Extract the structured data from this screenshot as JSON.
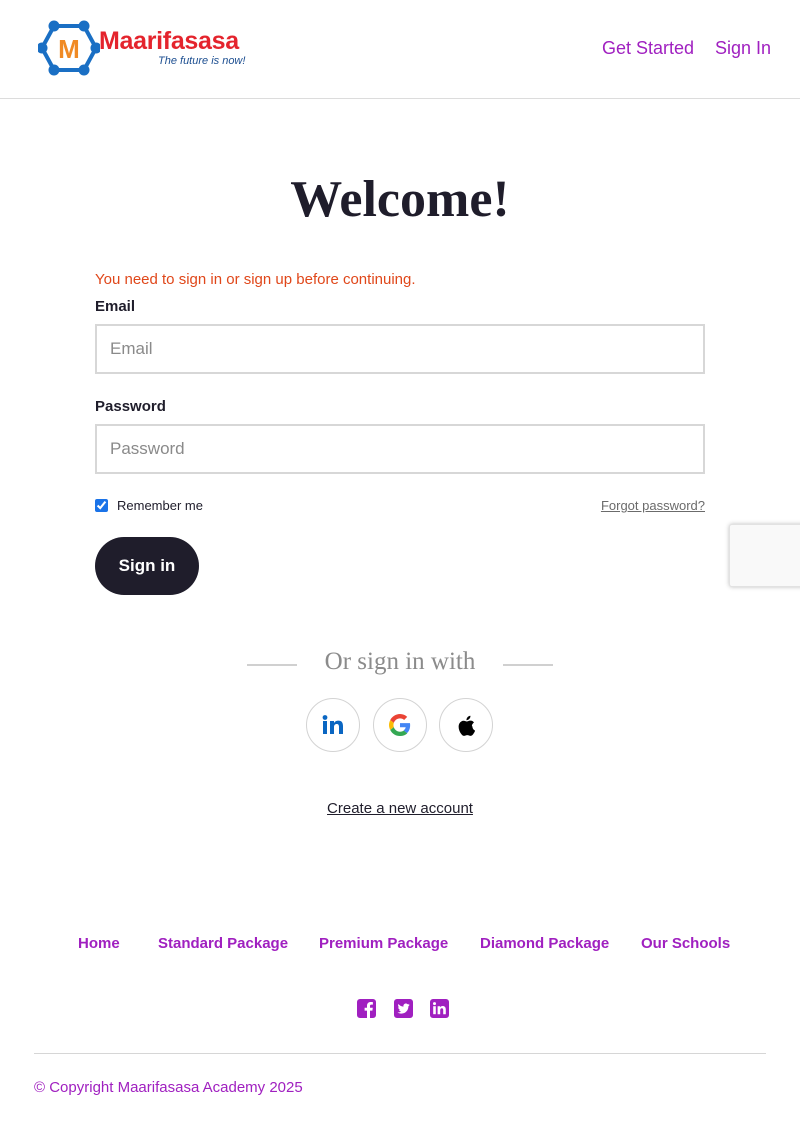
{
  "brand": {
    "name": "Maarifasasa",
    "tagline": "The future is now!",
    "logo_letter": "M"
  },
  "nav": {
    "get_started": "Get Started",
    "sign_in": "Sign In"
  },
  "page": {
    "title": "Welcome!",
    "alert": "You need to sign in or sign up before continuing."
  },
  "form": {
    "email_label": "Email",
    "email_placeholder": "Email",
    "email_value": "",
    "password_label": "Password",
    "password_placeholder": "Password",
    "password_value": "",
    "remember_label": "Remember me",
    "remember_checked": true,
    "forgot_label": "Forgot password?",
    "submit_label": "Sign in"
  },
  "social_login": {
    "heading": "Or sign in with",
    "providers": [
      "linkedin-icon",
      "google-icon",
      "apple-icon"
    ]
  },
  "create_account": "Create a new account",
  "footer": {
    "links": [
      "Home",
      "Standard Package",
      "Premium Package",
      "Diamond Package",
      "Our Schools"
    ],
    "social_icons": [
      "facebook-icon",
      "twitter-icon",
      "linkedin-icon"
    ],
    "copyright": "© Copyright Maarifasasa Academy 2025"
  },
  "colors": {
    "accent": "#a020c0",
    "alert": "#e0471a",
    "button": "#1f1d2b",
    "logo_text": "#e4242d",
    "logo_tagline": "#1d4f91",
    "logo_nodes": "#1a6fc4"
  }
}
